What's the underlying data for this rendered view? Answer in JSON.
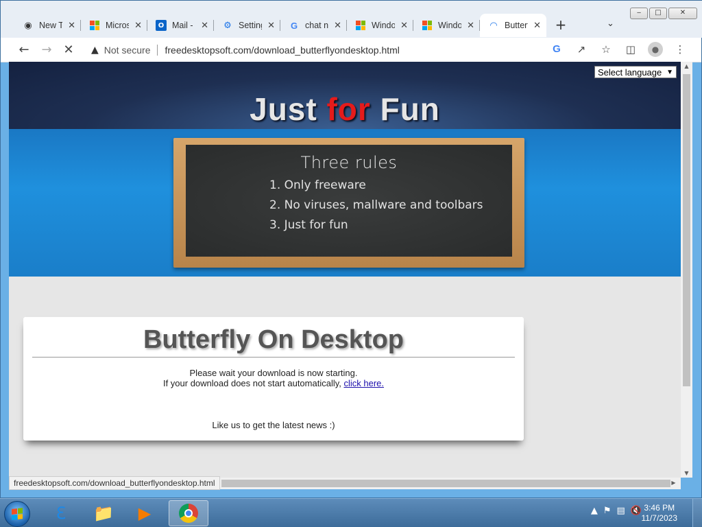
{
  "window": {
    "controls": [
      "‒",
      "□",
      "✕"
    ]
  },
  "tabs": [
    {
      "label": "New Tab",
      "icon": "chrome-icon"
    },
    {
      "label": "Microsoft",
      "icon": "microsoft-icon"
    },
    {
      "label": "Mail - ",
      "icon": "outlook-icon"
    },
    {
      "label": "Settings",
      "icon": "gear-icon"
    },
    {
      "label": "chat n",
      "icon": "google-icon"
    },
    {
      "label": "Windows",
      "icon": "microsoft-icon"
    },
    {
      "label": "Windows",
      "icon": "microsoft-icon"
    },
    {
      "label": "Butterfly",
      "icon": "loading-icon",
      "active": true
    }
  ],
  "toolbar": {
    "security_label": "Not secure",
    "url": "freedesktopsoft.com/download_butterflyondesktop.html"
  },
  "page": {
    "language_select": "Select language",
    "logo_part1": "Just ",
    "logo_part2": "for",
    "logo_part3": " Fun",
    "board_title": "Three rules",
    "rules": [
      "1. Only freeware",
      "2. No viruses, mallware and toolbars",
      "3. Just for fun"
    ],
    "card_title": "Butterfly On Desktop",
    "msg_line1": "Please wait your download is now starting.",
    "msg_line2": "If your download does not start automatically, ",
    "msg_link": "click here.",
    "like_text": "Like us to get the latest news :)"
  },
  "status_bar": "freedesktopsoft.com/download_butterflyondesktop.html",
  "taskbar": {
    "time": "3:46 PM",
    "date": "11/7/2023"
  },
  "colors": {
    "logo_accent": "#e51b1b",
    "link": "#1a0dab"
  }
}
